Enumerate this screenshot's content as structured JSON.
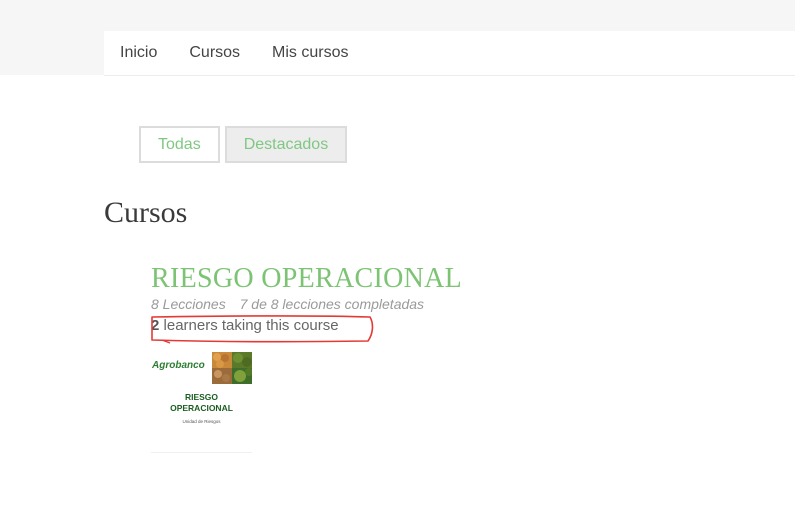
{
  "nav": {
    "items": [
      {
        "label": "Inicio"
      },
      {
        "label": "Cursos"
      },
      {
        "label": "Mis cursos"
      }
    ]
  },
  "filters": {
    "all_label": "Todas",
    "featured_label": "Destacados"
  },
  "page_title": "Cursos",
  "course": {
    "title": "RIESGO OPERACIONAL",
    "lessons": "8 Lecciones",
    "progress": "7 de 8 lecciones completadas",
    "learners_count": "2",
    "learners_text": "learners taking this course",
    "thumbnail": {
      "logo_text": "Agrobanco",
      "line1": "RIESGO",
      "line2": "OPERACIONAL",
      "subtitle": "Unidad de Riesgos"
    }
  },
  "colors": {
    "accent_green": "#7cc473",
    "annotation_red": "#e53935"
  }
}
